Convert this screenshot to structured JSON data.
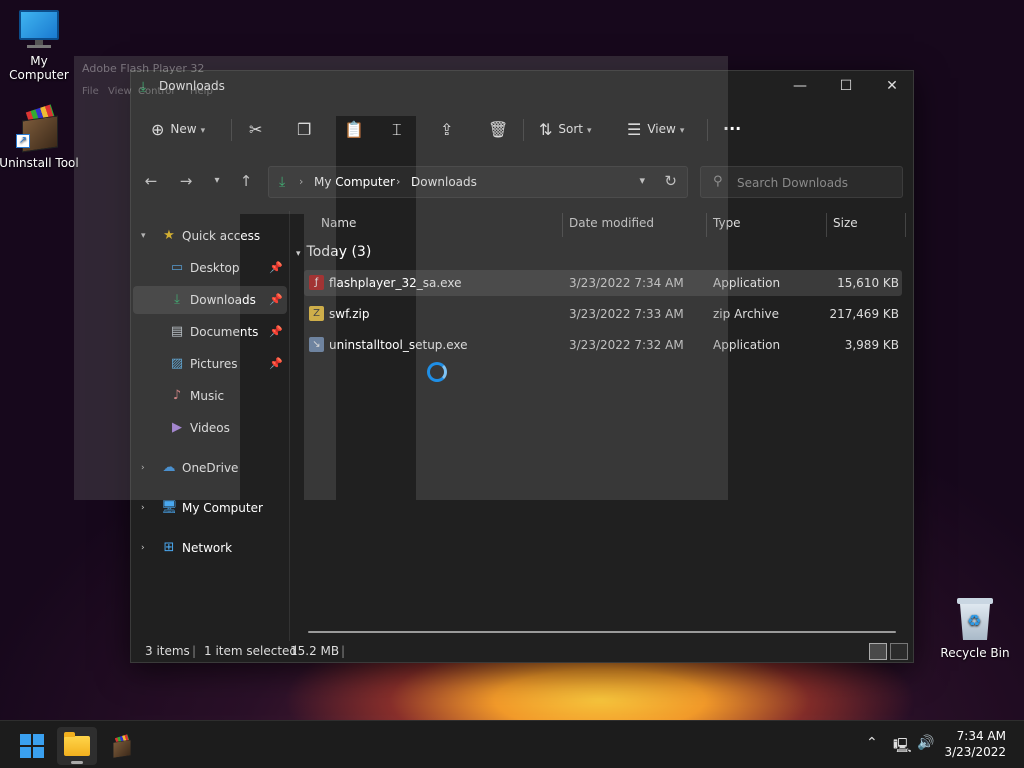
{
  "desktop": {
    "icons": [
      {
        "label": "My Computer"
      },
      {
        "label": "Uninstall Tool"
      },
      {
        "label": "Recycle Bin"
      }
    ]
  },
  "ghost_window": {
    "title": "Adobe Flash Player 32",
    "menu": [
      "File",
      "View",
      "Control",
      "Help"
    ]
  },
  "window": {
    "title": "Downloads",
    "toolbar": {
      "new_label": "New",
      "sort_label": "Sort",
      "view_label": "View",
      "more_label": "···"
    },
    "address": {
      "crumbs": [
        "My Computer",
        "Downloads"
      ]
    },
    "search": {
      "placeholder": "Search Downloads"
    },
    "sidebar": {
      "quick_access": "Quick access",
      "items": [
        {
          "label": "Desktop",
          "icon": "desktop-icon"
        },
        {
          "label": "Downloads",
          "icon": "download-icon"
        },
        {
          "label": "Documents",
          "icon": "documents-icon"
        },
        {
          "label": "Pictures",
          "icon": "pictures-icon"
        },
        {
          "label": "Music",
          "icon": "music-icon"
        },
        {
          "label": "Videos",
          "icon": "videos-icon"
        }
      ],
      "onedrive": "OneDrive",
      "mycomputer": "My Computer",
      "network": "Network"
    },
    "columns": {
      "name": "Name",
      "date": "Date modified",
      "type": "Type",
      "size": "Size"
    },
    "group_label": "Today (3)",
    "files": [
      {
        "name": "flashplayer_32_sa.exe",
        "date": "3/23/2022 7:34 AM",
        "type": "Application",
        "size": "15,610 KB",
        "icon": "flash-icon"
      },
      {
        "name": "swf.zip",
        "date": "3/23/2022 7:33 AM",
        "type": "zip Archive",
        "size": "217,469 KB",
        "icon": "zip-icon"
      },
      {
        "name": "uninstalltool_setup.exe",
        "date": "3/23/2022 7:32 AM",
        "type": "Application",
        "size": "3,989 KB",
        "icon": "installer-icon"
      }
    ],
    "status": {
      "items": "3 items",
      "selected": "1 item selected",
      "size": "15.2 MB"
    }
  },
  "taskbar": {
    "time": "7:34 AM",
    "date": "3/23/2022"
  },
  "colors": {
    "accent": "#2fbf71",
    "window_bg": "#202020",
    "selection": "#3b3b3b",
    "spinner": "#1f8fe6"
  }
}
